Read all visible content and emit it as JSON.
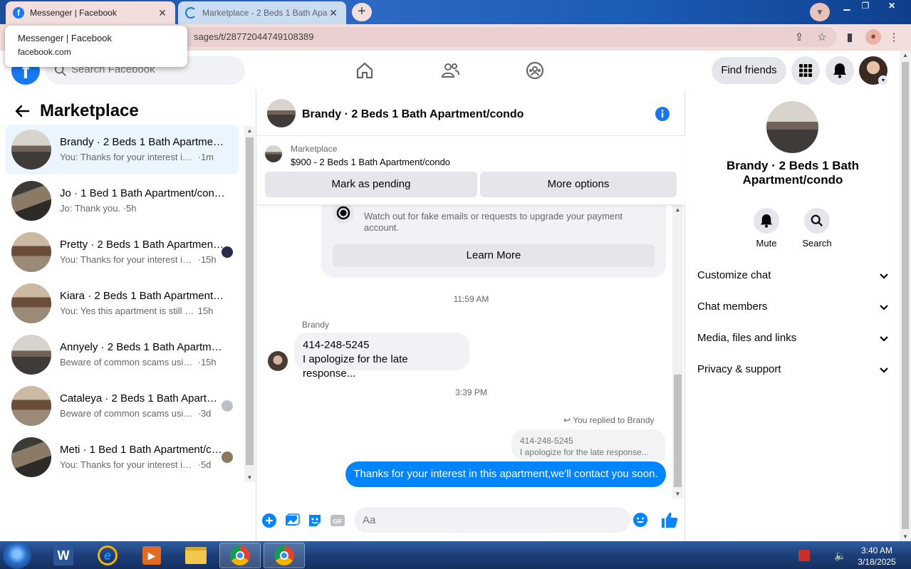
{
  "browser": {
    "tabs": [
      {
        "title": "Messenger | Facebook"
      },
      {
        "title": "Marketplace - 2 Beds 1 Bath Apar"
      }
    ],
    "url_visible": "sages/t/28772044749108389",
    "tooltip": {
      "title": "Messenger | Facebook",
      "domain": "facebook.com"
    }
  },
  "fb_header": {
    "logo": "f",
    "search_placeholder": "Search Facebook",
    "find_friends": "Find friends"
  },
  "left_panel": {
    "title": "Marketplace",
    "conversations": [
      {
        "name": "Brandy · 2 Beds 1 Bath Apartment/condo",
        "snippet": "You: Thanks for your interest in this apartment,we'll contact you soon.",
        "time": "·1m"
      },
      {
        "name": "Jo · 1 Bed 1 Bath Apartment/condo",
        "snippet": "Jo: Thank you.",
        "time": "·5h"
      },
      {
        "name": "Pretty · 2 Beds 1 Bath Apartment/condo",
        "snippet": "You: Thanks for your interest in this apartment",
        "time": "·15h"
      },
      {
        "name": "Kiara · 2 Beds 1 Bath Apartment/condo",
        "snippet": "You: Yes this apartment is still available",
        "time": "15h"
      },
      {
        "name": "Annyely · 2 Beds 1 Bath Apartment/condo",
        "snippet": "Beware of common scams using payment apps",
        "time": "·15h"
      },
      {
        "name": "Cataleya · 2 Beds 1 Bath Apartment/condo",
        "snippet": "Beware of common scams using payment apps",
        "time": "·3d"
      },
      {
        "name": "Meti · 1 Bed 1 Bath Apartment/condo",
        "snippet": "You: Thanks for your interest in this apartment",
        "time": "·5d"
      }
    ]
  },
  "chat": {
    "title": "Brandy · 2 Beds 1 Bath Apartment/condo",
    "marketplace_label": "Marketplace",
    "item": "$900 - 2 Beds 1 Bath Apartment/condo",
    "mark_pending": "Mark as pending",
    "more_options": "More options",
    "warning_text": "Watch out for fake emails or requests to upgrade your payment account.",
    "learn_more": "Learn More",
    "time1": "11:59 AM",
    "sender": "Brandy",
    "incoming_line1": "414-248-5245",
    "incoming_line2": "I apologize for the late response...",
    "time2": "3:39 PM",
    "replied_to": "You replied to Brandy",
    "quote_line1": "414-248-5245",
    "quote_line2": "I apologize for the late response...",
    "outgoing": "Thanks for your interest in this apartment,we'll contact you soon.",
    "composer_placeholder": "Aa"
  },
  "right_panel": {
    "name": "Brandy · 2 Beds 1 Bath Apartment/condo",
    "mute": "Mute",
    "search": "Search",
    "sections": [
      "Customize chat",
      "Chat members",
      "Media, files and links",
      "Privacy & support"
    ]
  },
  "taskbar": {
    "time": "3:40 AM",
    "date": "3/18/2025"
  },
  "colors": {
    "fb_blue": "#1877f2",
    "messenger_blue": "#0084ff",
    "selected_row": "#ebf5ff"
  }
}
